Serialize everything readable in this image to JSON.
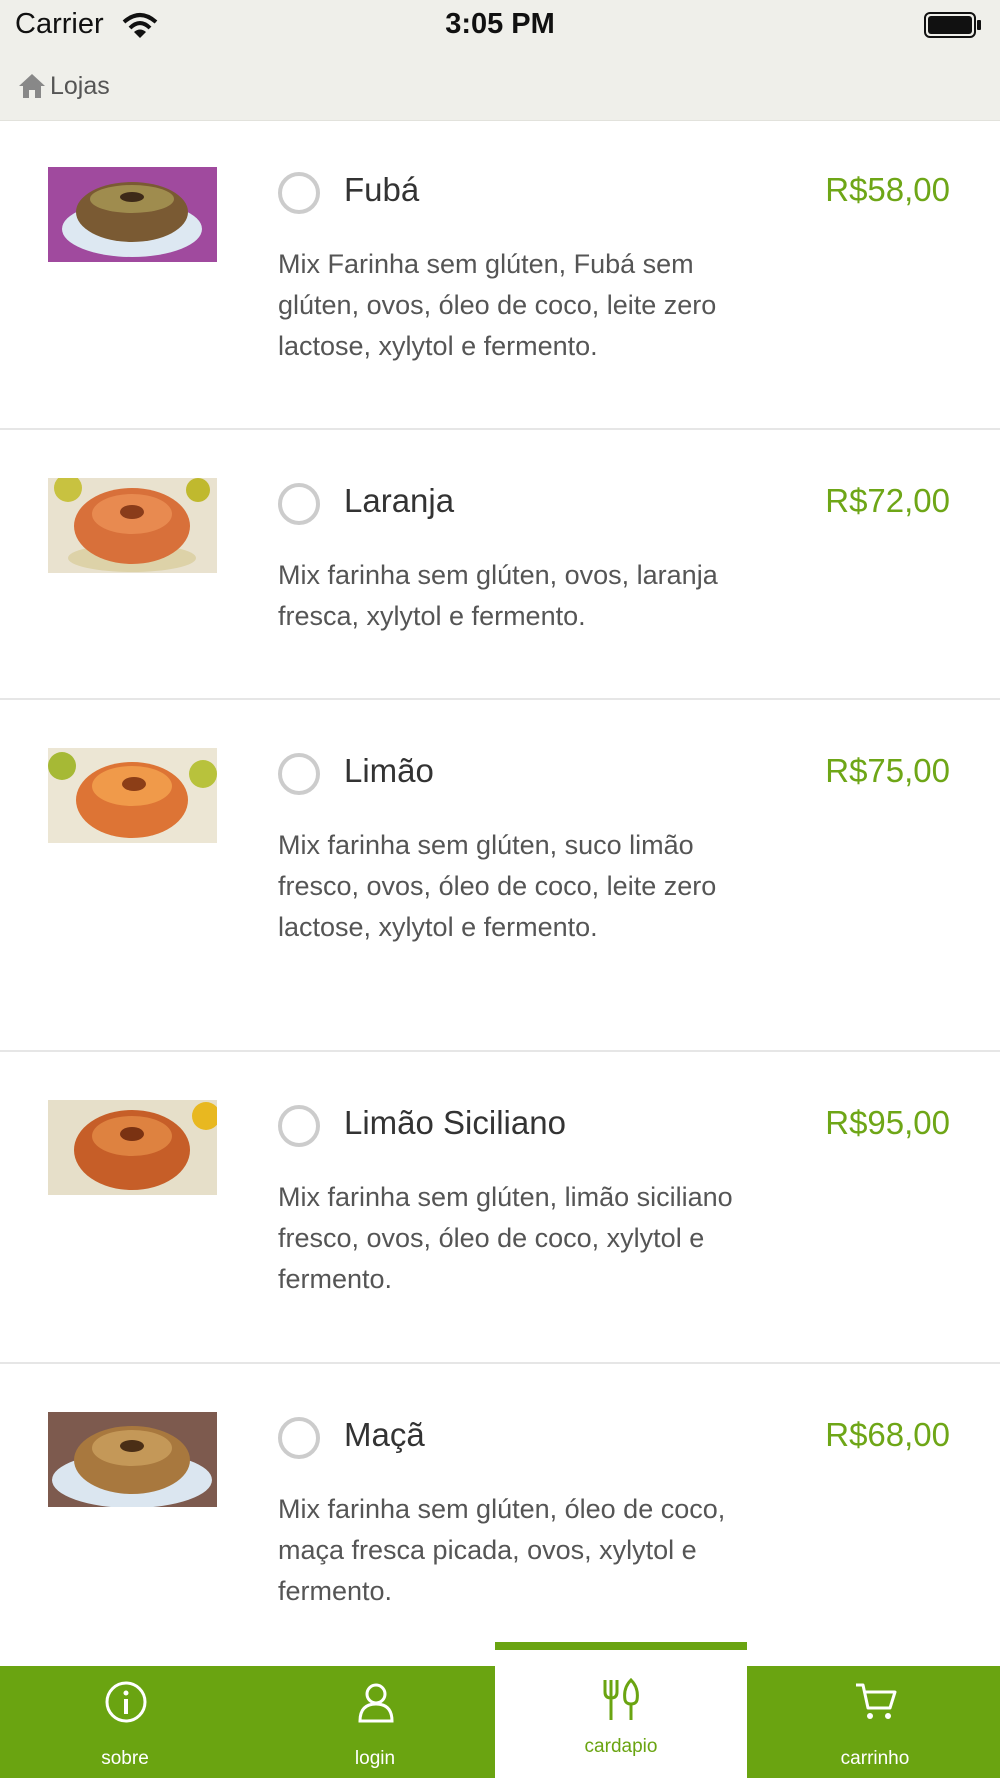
{
  "status_bar": {
    "carrier": "Carrier",
    "time": "3:05 PM"
  },
  "nav": {
    "back_label": "Lojas"
  },
  "products": [
    {
      "name": "Fubá",
      "price": "R$58,00",
      "description": "Mix Farinha sem glúten, Fubá sem glúten, ovos, óleo de coco, leite zero lactose, xylytol e fermento."
    },
    {
      "name": "Laranja",
      "price": "R$72,00",
      "description": "Mix farinha sem glúten, ovos, laranja fresca, xylytol e fermento."
    },
    {
      "name": "Limão",
      "price": "R$75,00",
      "description": "Mix farinha sem glúten, suco limão fresco, ovos, óleo de coco, leite zero lactose, xylytol e fermento."
    },
    {
      "name": "Limão Siciliano",
      "price": "R$95,00",
      "description": "Mix farinha sem glúten, limão siciliano fresco, ovos, óleo de coco, xylytol e fermento."
    },
    {
      "name": "Maçã",
      "price": "R$68,00",
      "description": "Mix farinha sem glúten, óleo de coco, maça fresca picada, ovos, xylytol e fermento."
    }
  ],
  "tabs": [
    {
      "label": "sobre",
      "icon": "info-icon"
    },
    {
      "label": "login",
      "icon": "user-icon"
    },
    {
      "label": "cardapio",
      "icon": "cutlery-icon",
      "active": true
    },
    {
      "label": "carrinho",
      "icon": "cart-icon"
    }
  ],
  "colors": {
    "accent": "#6aa411",
    "price": "#6ea617",
    "bar_bg": "#efefea"
  }
}
